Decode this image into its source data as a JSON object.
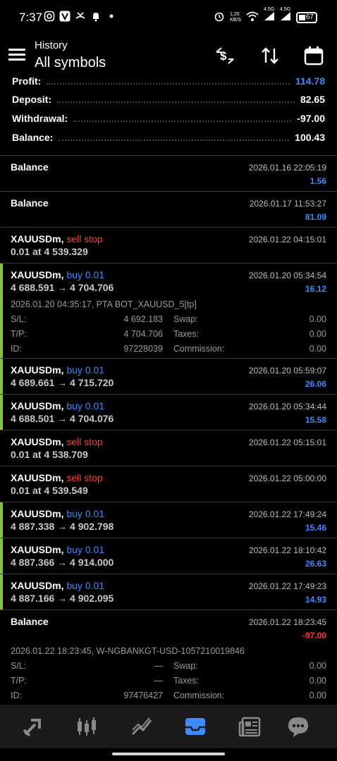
{
  "status_bar": {
    "time": "7:37",
    "net_speed": "1.20 KB/S",
    "signal1": "4.5G",
    "signal2": "4.5G",
    "battery": "67"
  },
  "app_bar": {
    "title": "History",
    "subtitle": "All symbols",
    "menu_icon": "hamburger-menu-icon",
    "actions": [
      "currency-exchange-icon",
      "sort-arrows-icon",
      "calendar-icon"
    ]
  },
  "summary": {
    "profit_label": "Profit:",
    "profit_value": "114.78",
    "deposit_label": "Deposit:",
    "deposit_value": "82.65",
    "withdrawal_label": "Withdrawal:",
    "withdrawal_value": "-97.00",
    "balance_label": "Balance:",
    "balance_value": "100.43"
  },
  "items": [
    {
      "title": "Balance",
      "time": "2026.01.16 22:05:19",
      "value": "1.56"
    },
    {
      "title": "Balance",
      "time": "2026.01.17 11:53:27",
      "value": "81.09"
    },
    {
      "symbol": "XAUUSDm,",
      "action": "sell stop",
      "line2": "0.01 at 4 539.329",
      "time": "2026.01.22 04:15:01"
    },
    {
      "symbol": "XAUUSDm,",
      "action": "buy 0.01",
      "line2": "4 688.591 → 4 704.706",
      "time": "2026.01.20 05:34:54",
      "value": "16.12",
      "details": {
        "comment": "2026.01.20 04:35:17, PTA BOT_XAUUSD_5[tp]",
        "sl_label": "S/L:",
        "sl": "4 692.183",
        "tp_label": "T/P:",
        "tp": "4 704.706",
        "id_label": "ID:",
        "id": "97228039",
        "swap_label": "Swap:",
        "swap": "0.00",
        "taxes_label": "Taxes:",
        "taxes": "0.00",
        "commission_label": "Commission:",
        "commission": "0.00"
      }
    },
    {
      "symbol": "XAUUSDm,",
      "action": "buy 0.01",
      "line2": "4 689.661 → 4 715.720",
      "time": "2026.01.20 05:59:07",
      "value": "26.06"
    },
    {
      "symbol": "XAUUSDm,",
      "action": "buy 0.01",
      "line2": "4 688.501 → 4 704.076",
      "time": "2026.01.20 05:34:44",
      "value": "15.58"
    },
    {
      "symbol": "XAUUSDm,",
      "action": "sell stop",
      "line2": "0.01 at 4 538.709",
      "time": "2026.01.22 05:15:01"
    },
    {
      "symbol": "XAUUSDm,",
      "action": "sell stop",
      "line2": "0.01 at 4 539.549",
      "time": "2026.01.22 05:00:00"
    },
    {
      "symbol": "XAUUSDm,",
      "action": "buy 0.01",
      "line2": "4 887.338 → 4 902.798",
      "time": "2026.01.22 17:49:24",
      "value": "15.46"
    },
    {
      "symbol": "XAUUSDm,",
      "action": "buy 0.01",
      "line2": "4 887.366 → 4 914.000",
      "time": "2026.01.22 18:10:42",
      "value": "26.63"
    },
    {
      "symbol": "XAUUSDm,",
      "action": "buy 0.01",
      "line2": "4 887.166 → 4 902.095",
      "time": "2026.01.22 17:49:23",
      "value": "14.93"
    },
    {
      "title": "Balance",
      "time": "2026.01.22 18:23:45",
      "value": "-97.00",
      "details": {
        "comment": "2026.01.22 18:23:45, W-NGBANKGT-USD-1057210019846",
        "sl_label": "S/L:",
        "sl": "—",
        "tp_label": "T/P:",
        "tp": "—",
        "id_label": "ID:",
        "id": "97476427",
        "swap_label": "Swap:",
        "swap": "0.00",
        "taxes_label": "Taxes:",
        "taxes": "0.00",
        "commission_label": "Commission:",
        "commission": "0.00"
      }
    }
  ],
  "bottom_nav": [
    "trade-arrows-icon",
    "candlestick-chart-icon",
    "trend-chart-icon",
    "history-inbox-icon",
    "news-icon",
    "chat-icon"
  ],
  "colors": {
    "accent_green": "#7ec634",
    "blue": "#3d8bff",
    "red": "#ff3b3b",
    "background": "#000000"
  }
}
